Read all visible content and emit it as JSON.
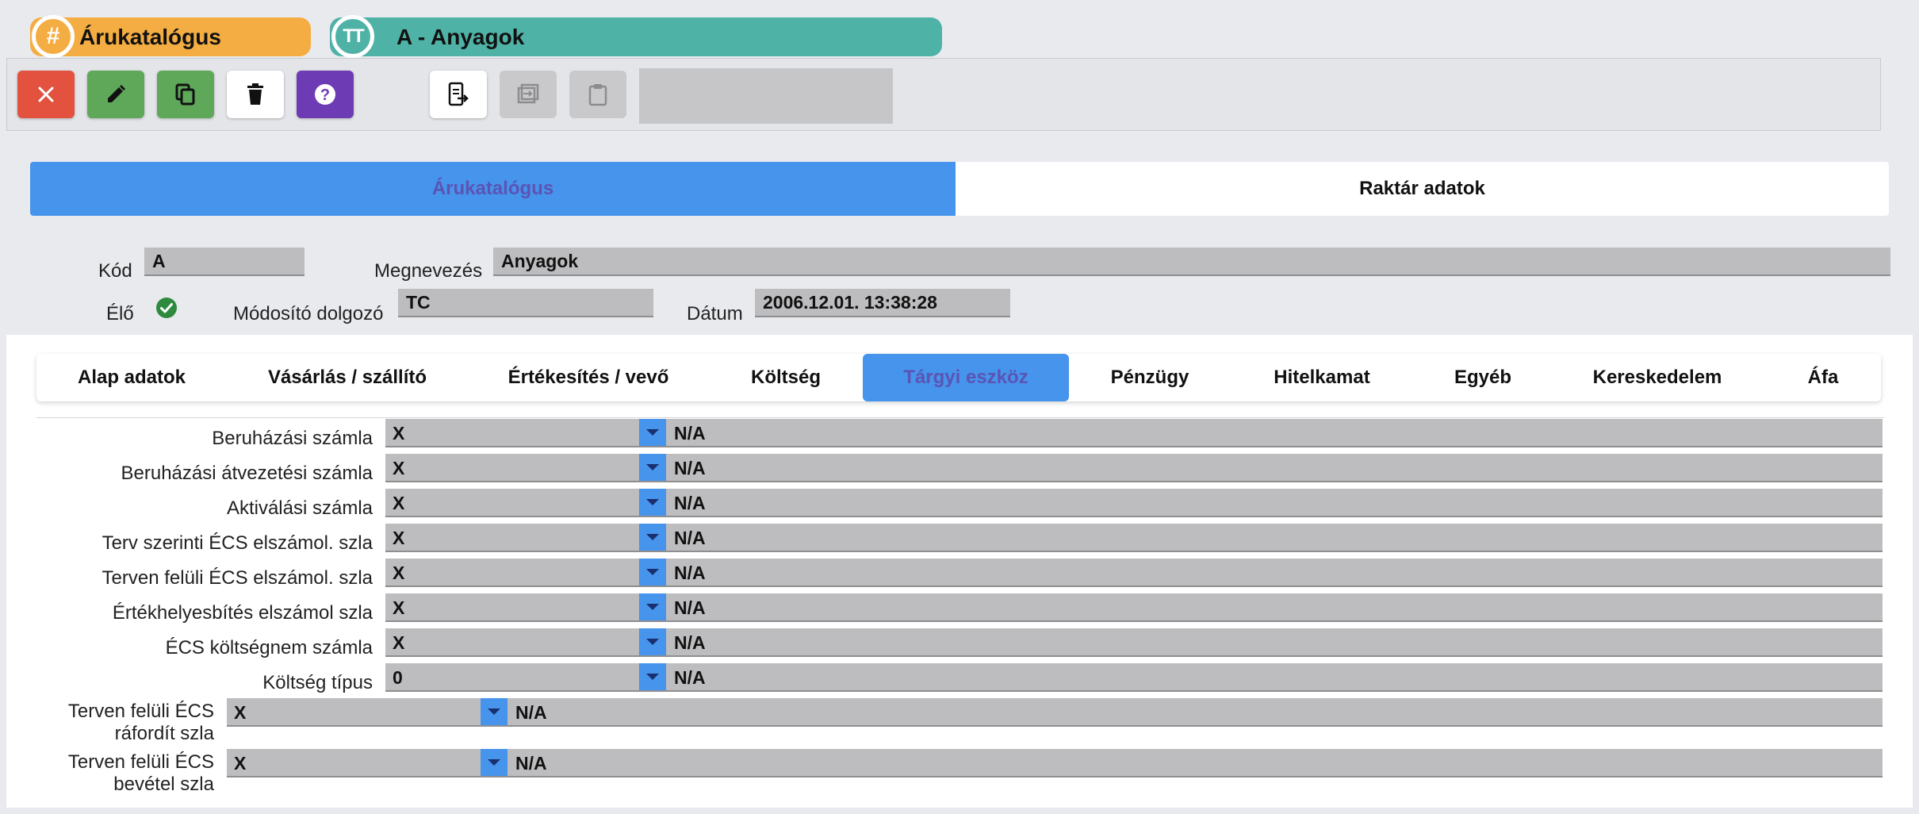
{
  "breadcrumb": {
    "items": [
      {
        "icon": "#",
        "label": "Árukatalógus"
      },
      {
        "icon": "TT",
        "label": "A - Anyagok"
      }
    ]
  },
  "toolbar": {
    "buttons": [
      {
        "name": "close",
        "color": "#e2523f"
      },
      {
        "name": "edit",
        "color": "#5fa85a"
      },
      {
        "name": "copy",
        "color": "#5fa85a"
      },
      {
        "name": "delete",
        "color": "#ffffff"
      },
      {
        "name": "help",
        "color": "#6d3cb5"
      },
      {
        "name": "export",
        "color": "#ffffff"
      },
      {
        "name": "import",
        "color": "#c9c9cb"
      },
      {
        "name": "paste",
        "color": "#c9c9cb"
      }
    ]
  },
  "tabs": [
    {
      "label": "Árukatalógus",
      "active": true
    },
    {
      "label": "Raktár adatok",
      "active": false
    }
  ],
  "header": {
    "kod_label": "Kód",
    "kod_value": "A",
    "megnevezes_label": "Megnevezés",
    "megnevezes_value": "Anyagok",
    "elo_label": "Élő",
    "elo_checked": true,
    "modosito_label": "Módosító dolgozó",
    "modosito_value": "TC",
    "datum_label": "Dátum",
    "datum_value": "2006.12.01. 13:38:28"
  },
  "subtabs": [
    {
      "label": "Alap adatok",
      "active": false
    },
    {
      "label": "Vásárlás / szállító",
      "active": false
    },
    {
      "label": "Értékesítés / vevő",
      "active": false
    },
    {
      "label": "Költség",
      "active": false
    },
    {
      "label": "Tárgyi eszköz",
      "active": true
    },
    {
      "label": "Pénzügy",
      "active": false
    },
    {
      "label": "Hitelkamat",
      "active": false
    },
    {
      "label": "Egyéb",
      "active": false
    },
    {
      "label": "Kereskedelem",
      "active": false
    },
    {
      "label": "Áfa",
      "active": false
    }
  ],
  "rows": [
    {
      "label": "Beruházási számla",
      "value": "X",
      "desc": "N/A"
    },
    {
      "label": "Beruházási átvezetési számla",
      "value": "X",
      "desc": "N/A"
    },
    {
      "label": "Aktiválási számla",
      "value": "X",
      "desc": "N/A"
    },
    {
      "label": "Terv szerinti ÉCS elszámol. szla",
      "value": "X",
      "desc": "N/A"
    },
    {
      "label": "Terven felüli ÉCS elszámol. szla",
      "value": "X",
      "desc": "N/A"
    },
    {
      "label": "Értékhelyesbítés elszámol szla",
      "value": "X",
      "desc": "N/A"
    },
    {
      "label": "ÉCS költségnem számla",
      "value": "X",
      "desc": "N/A"
    },
    {
      "label": "Költség típus",
      "value": "0",
      "desc": "N/A"
    },
    {
      "label_line1": "Terven felüli ÉCS",
      "label_line2": "ráfordít szla",
      "value": "X",
      "desc": "N/A"
    },
    {
      "label_line1": "Terven felüli ÉCS",
      "label_line2": "bevétel szla",
      "value": "X",
      "desc": "N/A"
    }
  ],
  "colors": {
    "accent_blue": "#4694ec",
    "active_tab_text": "#5b54b5",
    "breadcrumb_orange": "#f4ad42",
    "breadcrumb_teal": "#4fb2a6",
    "check_green": "#2e8b3e"
  }
}
